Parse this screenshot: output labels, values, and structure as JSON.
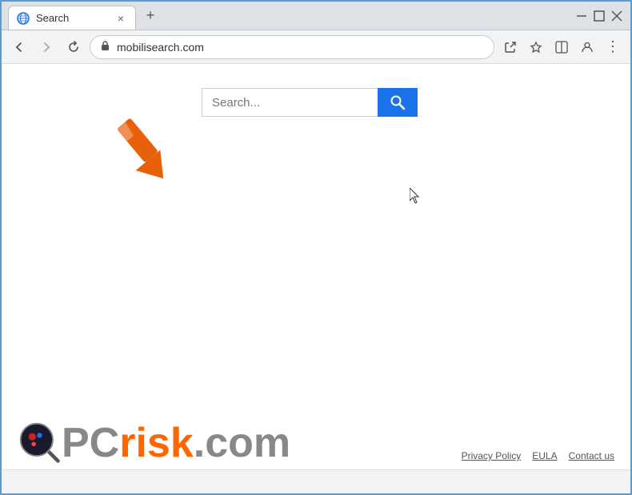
{
  "window": {
    "title": "Search",
    "url": "mobilisearch.com",
    "tab_close_icon": "×",
    "new_tab_icon": "+",
    "win_minimize": "—",
    "win_maximize": "□",
    "win_close": "✕"
  },
  "nav": {
    "back_icon": "←",
    "forward_icon": "→",
    "refresh_icon": "↻",
    "lock_icon": "🔒",
    "share_icon": "⬆",
    "star_icon": "☆",
    "split_icon": "⊡",
    "profile_icon": "👤",
    "menu_icon": "⋮"
  },
  "search": {
    "placeholder": "Search...",
    "button_icon": "🔍"
  },
  "footer": {
    "logo_text_pc": "PC",
    "logo_text_risk": "risk",
    "logo_text_com": ".com",
    "links": [
      {
        "label": "Privacy Policy",
        "id": "privacy-policy"
      },
      {
        "label": "EULA",
        "id": "eula"
      },
      {
        "label": "Contact us",
        "id": "contact-us"
      }
    ]
  }
}
